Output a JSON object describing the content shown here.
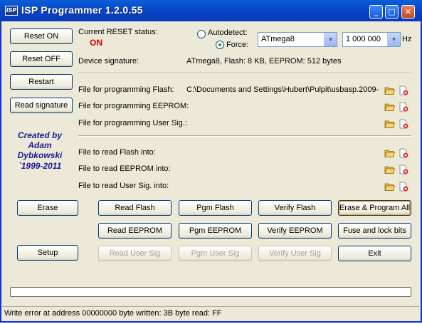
{
  "window": {
    "title": "ISP Programmer 1.2.0.55",
    "icon_text": "ISP",
    "minimize_glyph": "_",
    "maximize_glyph": "□",
    "close_glyph": "✕"
  },
  "left_buttons": {
    "reset_on": "Reset ON",
    "reset_off": "Reset OFF",
    "restart": "Restart",
    "read_signature": "Read signature"
  },
  "credit": {
    "line1": "Created by",
    "line2": "Adam",
    "line3": "Dybkowski",
    "line4": "`1999-2011"
  },
  "reset": {
    "label": "Current RESET status:",
    "value": "ON",
    "value_color": "#e00000"
  },
  "device": {
    "autodetect_label": "Autodetect:",
    "force_label": "Force:",
    "selected_mode": "Force",
    "chip": "ATmega8",
    "frequency": "1 000 000",
    "frequency_unit": "Hz"
  },
  "signature": {
    "label": "Device signature:",
    "value": "ATmega8, Flash: 8 KB, EEPROM: 512 bytes"
  },
  "files_program": [
    {
      "label": "File for programming Flash:",
      "value": "C:\\Documents and Settings\\Hubert\\Pulpit\\usbasp.2009-"
    },
    {
      "label": "File for programming EEPROM:",
      "value": ""
    },
    {
      "label": "File for programming User Sig.:",
      "value": ""
    }
  ],
  "files_read": [
    {
      "label": "File to read Flash into:",
      "value": ""
    },
    {
      "label": "File to read EEPROM into:",
      "value": ""
    },
    {
      "label": "File to read User Sig. into:",
      "value": ""
    }
  ],
  "actions": {
    "erase": "Erase",
    "setup": "Setup",
    "read_flash": "Read Flash",
    "pgm_flash": "Pgm Flash",
    "verify_flash": "Verify Flash",
    "erase_program_all": "Erase & Program All",
    "read_eeprom": "Read EEPROM",
    "pgm_eeprom": "Pgm EEPROM",
    "verify_eeprom": "Verify EEPROM",
    "fuse_lock": "Fuse and lock bits",
    "read_user_sig": "Read User Sig",
    "pgm_user_sig": "Pgm User Sig",
    "verify_user_sig": "Verify User Sig",
    "exit": "Exit"
  },
  "progress": {
    "fraction": 0
  },
  "status_bar": "Write error at address 00000000 byte written: 3B byte read: FF",
  "colors": {
    "titlebar": "#0842c4",
    "window_bg": "#ece9d8",
    "credit_text": "#1b1b8f",
    "folder_icon": "#e8b83a",
    "clear_icon": "#d42020"
  }
}
